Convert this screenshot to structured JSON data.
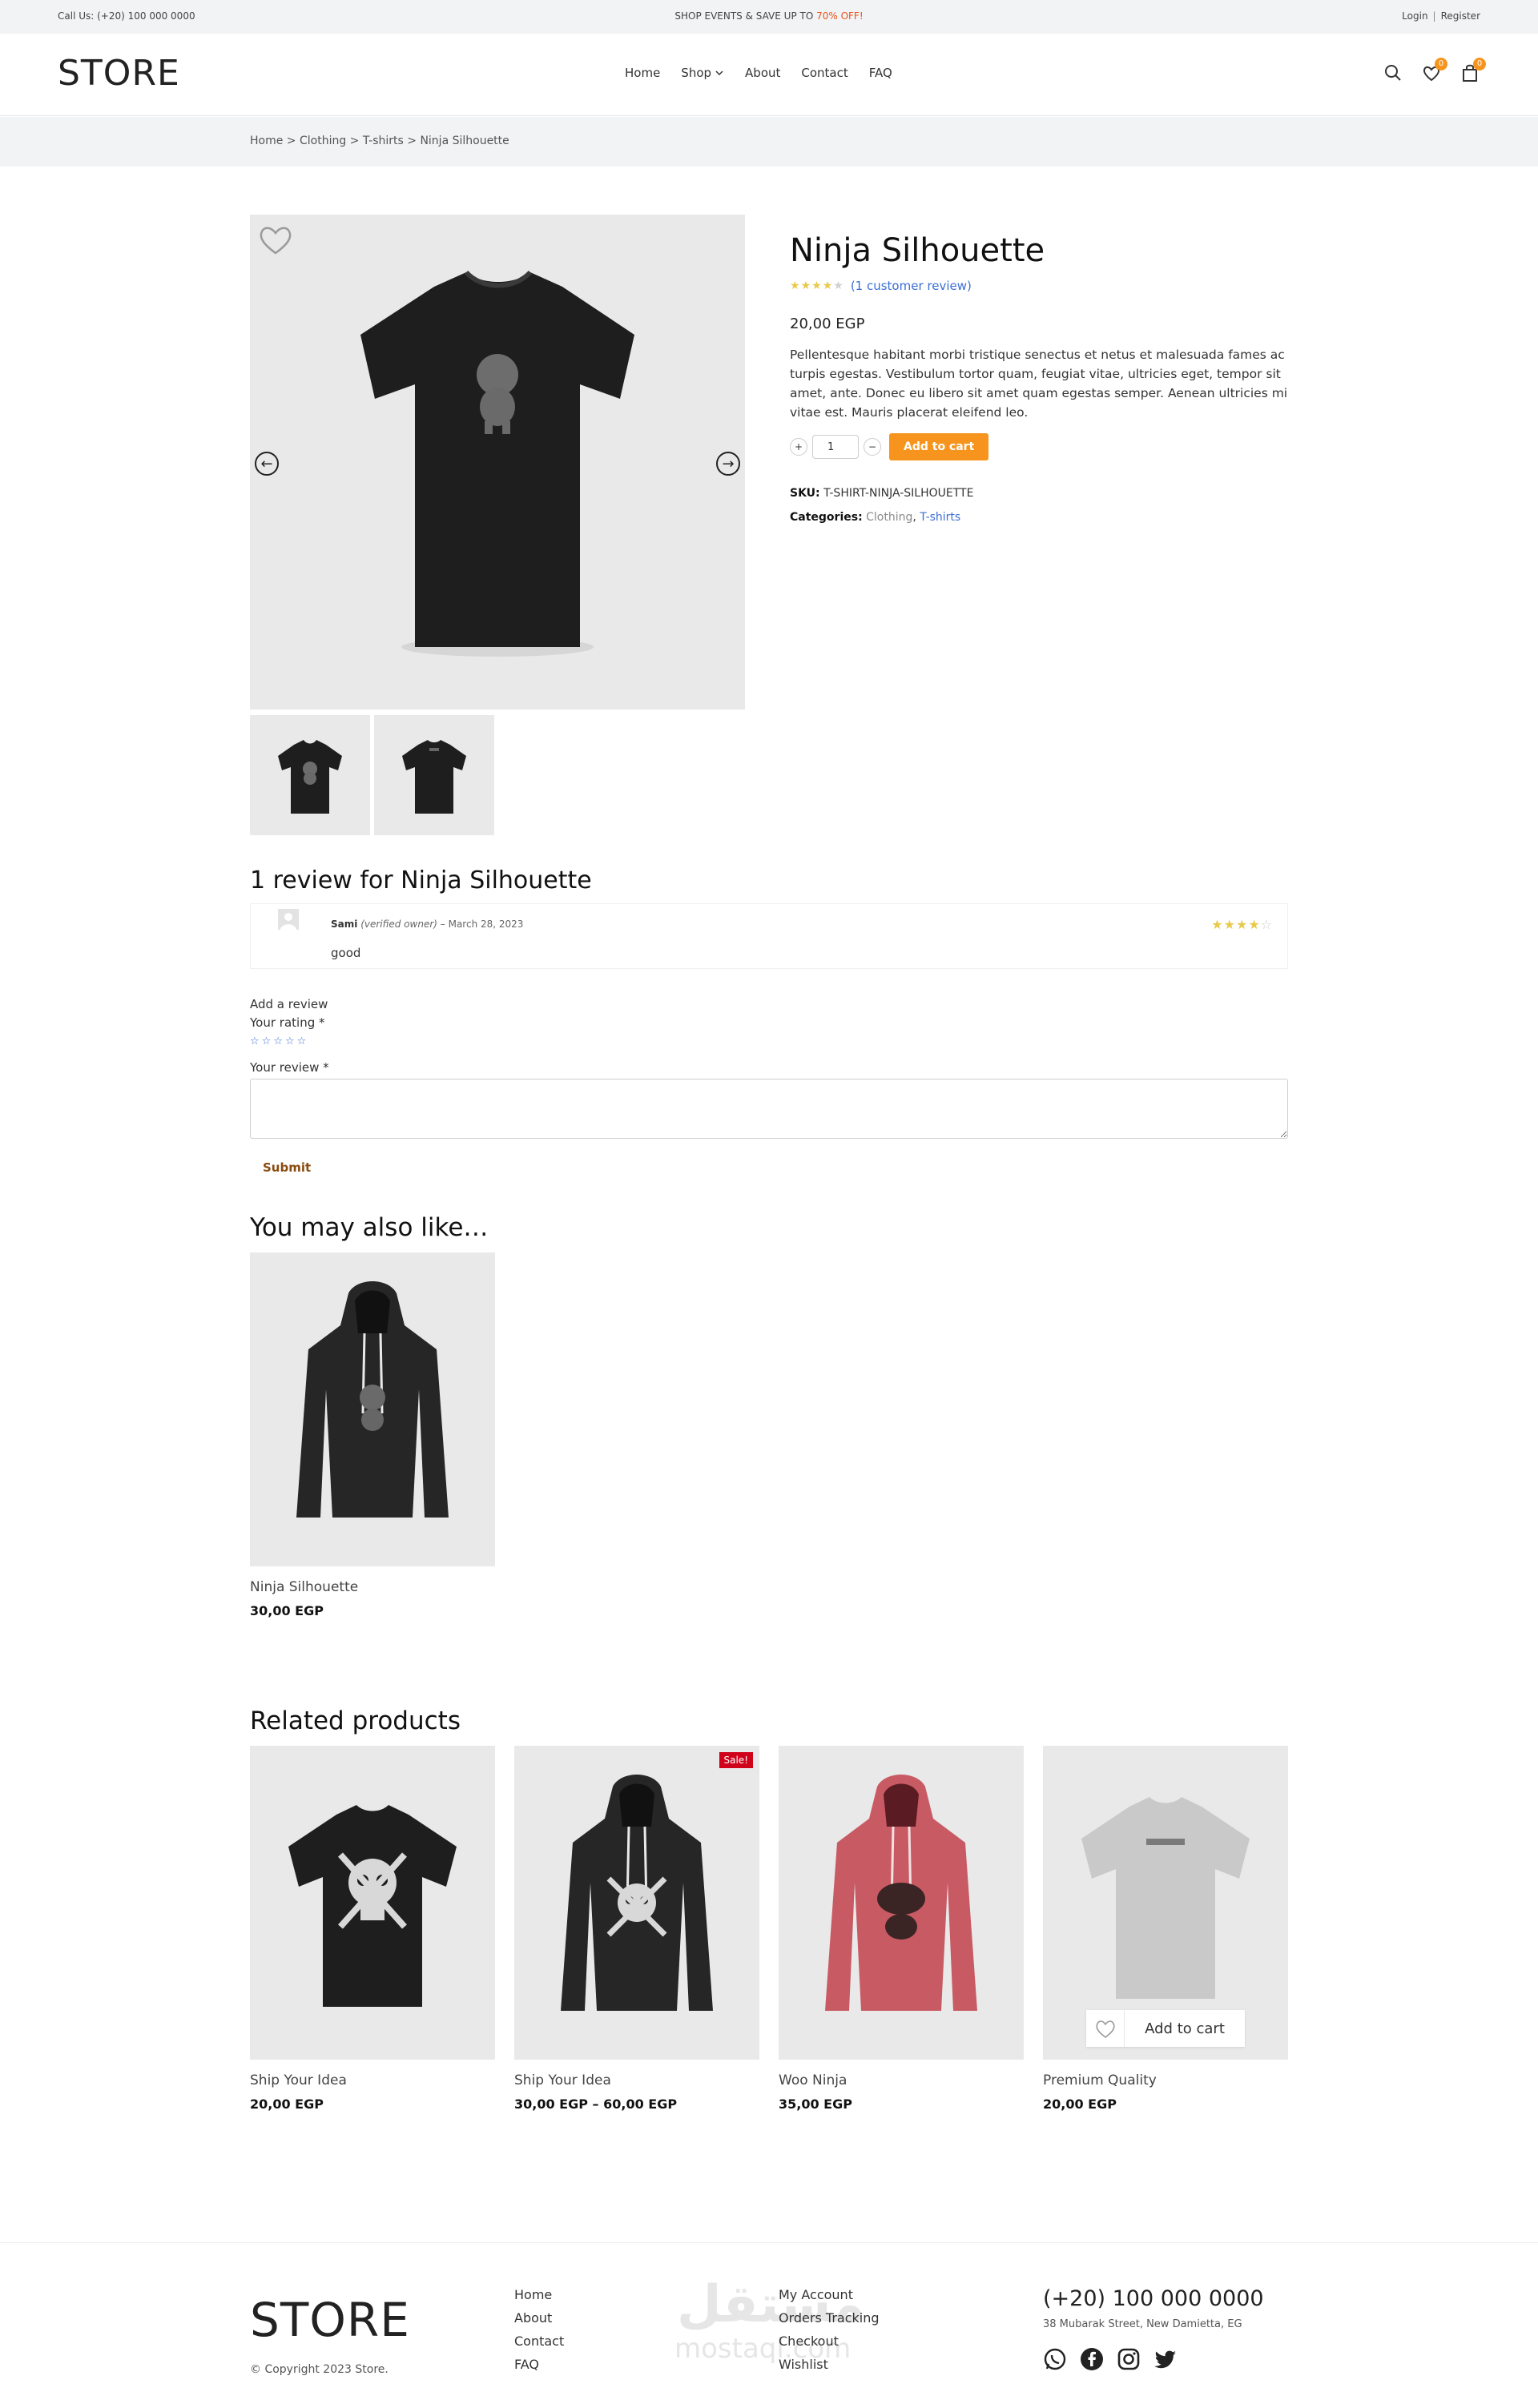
{
  "topbar": {
    "call": "Call Us: (+20) 100 000 0000",
    "promo_prefix": "SHOP EVENTS & SAVE UP TO ",
    "promo_highlight": "70% OFF!",
    "login": "Login",
    "separator": "|",
    "register": "Register"
  },
  "header": {
    "logo": "STORE",
    "nav": [
      "Home",
      "Shop",
      "About",
      "Contact",
      "FAQ"
    ],
    "wishlist_count": "0",
    "cart_count": "0"
  },
  "breadcrumb": {
    "items": [
      "Home",
      "Clothing",
      "T-shirts",
      "Ninja Silhouette"
    ],
    "sep": " > "
  },
  "product": {
    "title": "Ninja Silhouette",
    "rating": 4,
    "review_link": "(1 customer review)",
    "price": "20,00 EGP",
    "description": "Pellentesque habitant morbi tristique senectus et netus et malesuada fames ac turpis egestas. Vestibulum tortor quam, feugiat vitae, ultricies eget, tempor sit amet, ante. Donec eu libero sit amet quam egestas semper. Aenean ultricies mi vitae est. Mauris placerat eleifend leo.",
    "quantity": "1",
    "plus": "+",
    "minus": "−",
    "add_to_cart": "Add to cart",
    "sku_label": "SKU:",
    "sku": "T-SHIRT-NINJA-SILHOUETTE",
    "categories_label": "Categories:",
    "category_1": "Clothing",
    "category_sep": ", ",
    "category_2": "T-shirts"
  },
  "reviews": {
    "heading": "1 review for Ninja Silhouette",
    "items": [
      {
        "author": "Sami",
        "verified": "(verified owner)",
        "dash": " – ",
        "date": "March 28, 2023",
        "text": "good",
        "rating": 4
      }
    ],
    "add_review": "Add a review",
    "your_rating": "Your rating *",
    "your_review": "Your review *",
    "submit": "Submit"
  },
  "upsells": {
    "heading": "You may also like…",
    "items": [
      {
        "name": "Ninja Silhouette",
        "price": "30,00 EGP"
      }
    ]
  },
  "related": {
    "heading": "Related products",
    "items": [
      {
        "name": "Ship Your Idea",
        "price": "20,00 EGP",
        "sale": ""
      },
      {
        "name": "Ship Your Idea",
        "price": "30,00 EGP – 60,00 EGP",
        "sale": "Sale!"
      },
      {
        "name": "Woo Ninja",
        "price": "35,00 EGP",
        "sale": ""
      },
      {
        "name": "Premium Quality",
        "price": "20,00 EGP",
        "sale": "",
        "hover_add": "Add to cart"
      }
    ]
  },
  "footer": {
    "logo": "STORE",
    "copyright": "© Copyright 2023 Store.",
    "col1": [
      "Home",
      "About",
      "Contact",
      "FAQ"
    ],
    "col2": [
      "My Account",
      "Orders Tracking",
      "Checkout",
      "Wishlist"
    ],
    "phone": "(+20) 100 000 0000",
    "address": "38 Mubarak Street, New Damietta, EG",
    "social": [
      "whatsapp-icon",
      "facebook-icon",
      "instagram-icon",
      "twitter-icon"
    ],
    "watermark": "مستقل",
    "watermark_sub": "mostaql.com"
  },
  "colors": {
    "accent": "#f7941d",
    "link": "#3b6fd6",
    "star": "#e8c94a",
    "sale": "#d0021b",
    "promo": "#e8541c"
  }
}
